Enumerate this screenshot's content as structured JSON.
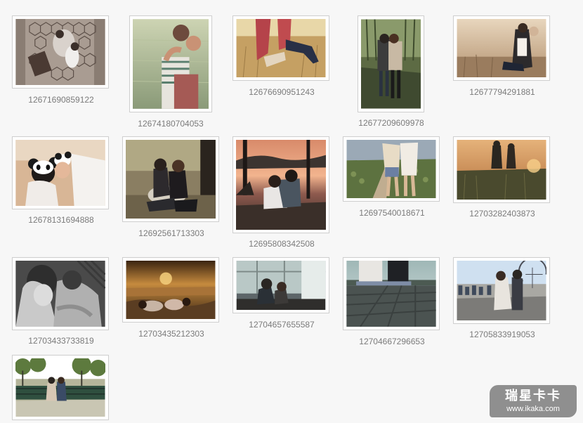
{
  "gallery": {
    "items": [
      {
        "caption": "12671690859122"
      },
      {
        "caption": "12674180704053"
      },
      {
        "caption": "12676690951243"
      },
      {
        "caption": "12677209609978"
      },
      {
        "caption": "12677794291881"
      },
      {
        "caption": "12678131694888"
      },
      {
        "caption": "12692561713303"
      },
      {
        "caption": "12695808342508"
      },
      {
        "caption": "12697540018671"
      },
      {
        "caption": "12703282403873"
      },
      {
        "caption": "12703433733819"
      },
      {
        "caption": "12703435212303"
      },
      {
        "caption": "12704657655587"
      },
      {
        "caption": "12704667296653"
      },
      {
        "caption": "12705833919053"
      },
      {
        "caption": ""
      }
    ]
  },
  "watermark": {
    "logo_text": "瑞星卡卡",
    "url": "www.ikaka.com"
  },
  "colors": {
    "background": "#f7f7f7",
    "frame_border": "#cfcfcf",
    "caption": "#7b7b7b",
    "watermark_bg": "#8f8f8f"
  }
}
